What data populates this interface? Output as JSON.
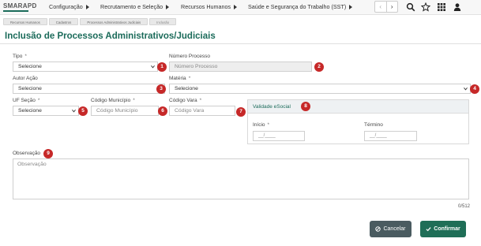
{
  "app": {
    "logo": "SMARAPD"
  },
  "nav": {
    "items": [
      "Configuração",
      "Recrutamento e Seleção",
      "Recursos Humanos",
      "Saúde e Segurança do Trabalho (SST)"
    ],
    "prev": "‹",
    "next": "›"
  },
  "breadcrumb": [
    "Recursos Humanos",
    "Cadastros",
    "Processos Administrativos Judiciais",
    "Inclusão"
  ],
  "page": {
    "title": "Inclusão de Processos Administrativos/Judiciais"
  },
  "form": {
    "tipo": {
      "label": "Tipo",
      "required": "*",
      "value": "Selecione"
    },
    "numero_processo": {
      "label": "Número Processo",
      "placeholder": "Número Processo"
    },
    "autor_acao": {
      "label": "Autor Ação",
      "value": "Selecione"
    },
    "materia": {
      "label": "Matéria",
      "required": "*",
      "value": "Selecione"
    },
    "uf_secao": {
      "label": "UF Seção",
      "required": "*",
      "value": "Selecione"
    },
    "codigo_municipio": {
      "label": "Código Município",
      "required": "*",
      "placeholder": "Código Município"
    },
    "codigo_vara": {
      "label": "Código Vara",
      "required": "*",
      "placeholder": "Código Vara"
    },
    "validade": {
      "title": "Validade eSocial",
      "inicio": {
        "label": "Início",
        "required": "*",
        "placeholder": "__/____"
      },
      "termino": {
        "label": "Término",
        "placeholder": "__/____"
      }
    },
    "observacao": {
      "label": "Observação",
      "placeholder": "Observação",
      "counter": "0/512"
    }
  },
  "annotations": [
    "1",
    "2",
    "3",
    "4",
    "5",
    "6",
    "7",
    "8",
    "9"
  ],
  "buttons": {
    "cancel": "Cancelar",
    "confirm": "Confirmar"
  },
  "colors": {
    "brand": "#1b6b5a",
    "badge": "#c62828",
    "cancel": "#4a5b60",
    "confirm": "#1f6e57"
  },
  "icons": [
    "search-icon",
    "star-icon",
    "apps-grid-icon",
    "user-icon",
    "chevron-down-icon",
    "ban-icon",
    "check-icon"
  ]
}
